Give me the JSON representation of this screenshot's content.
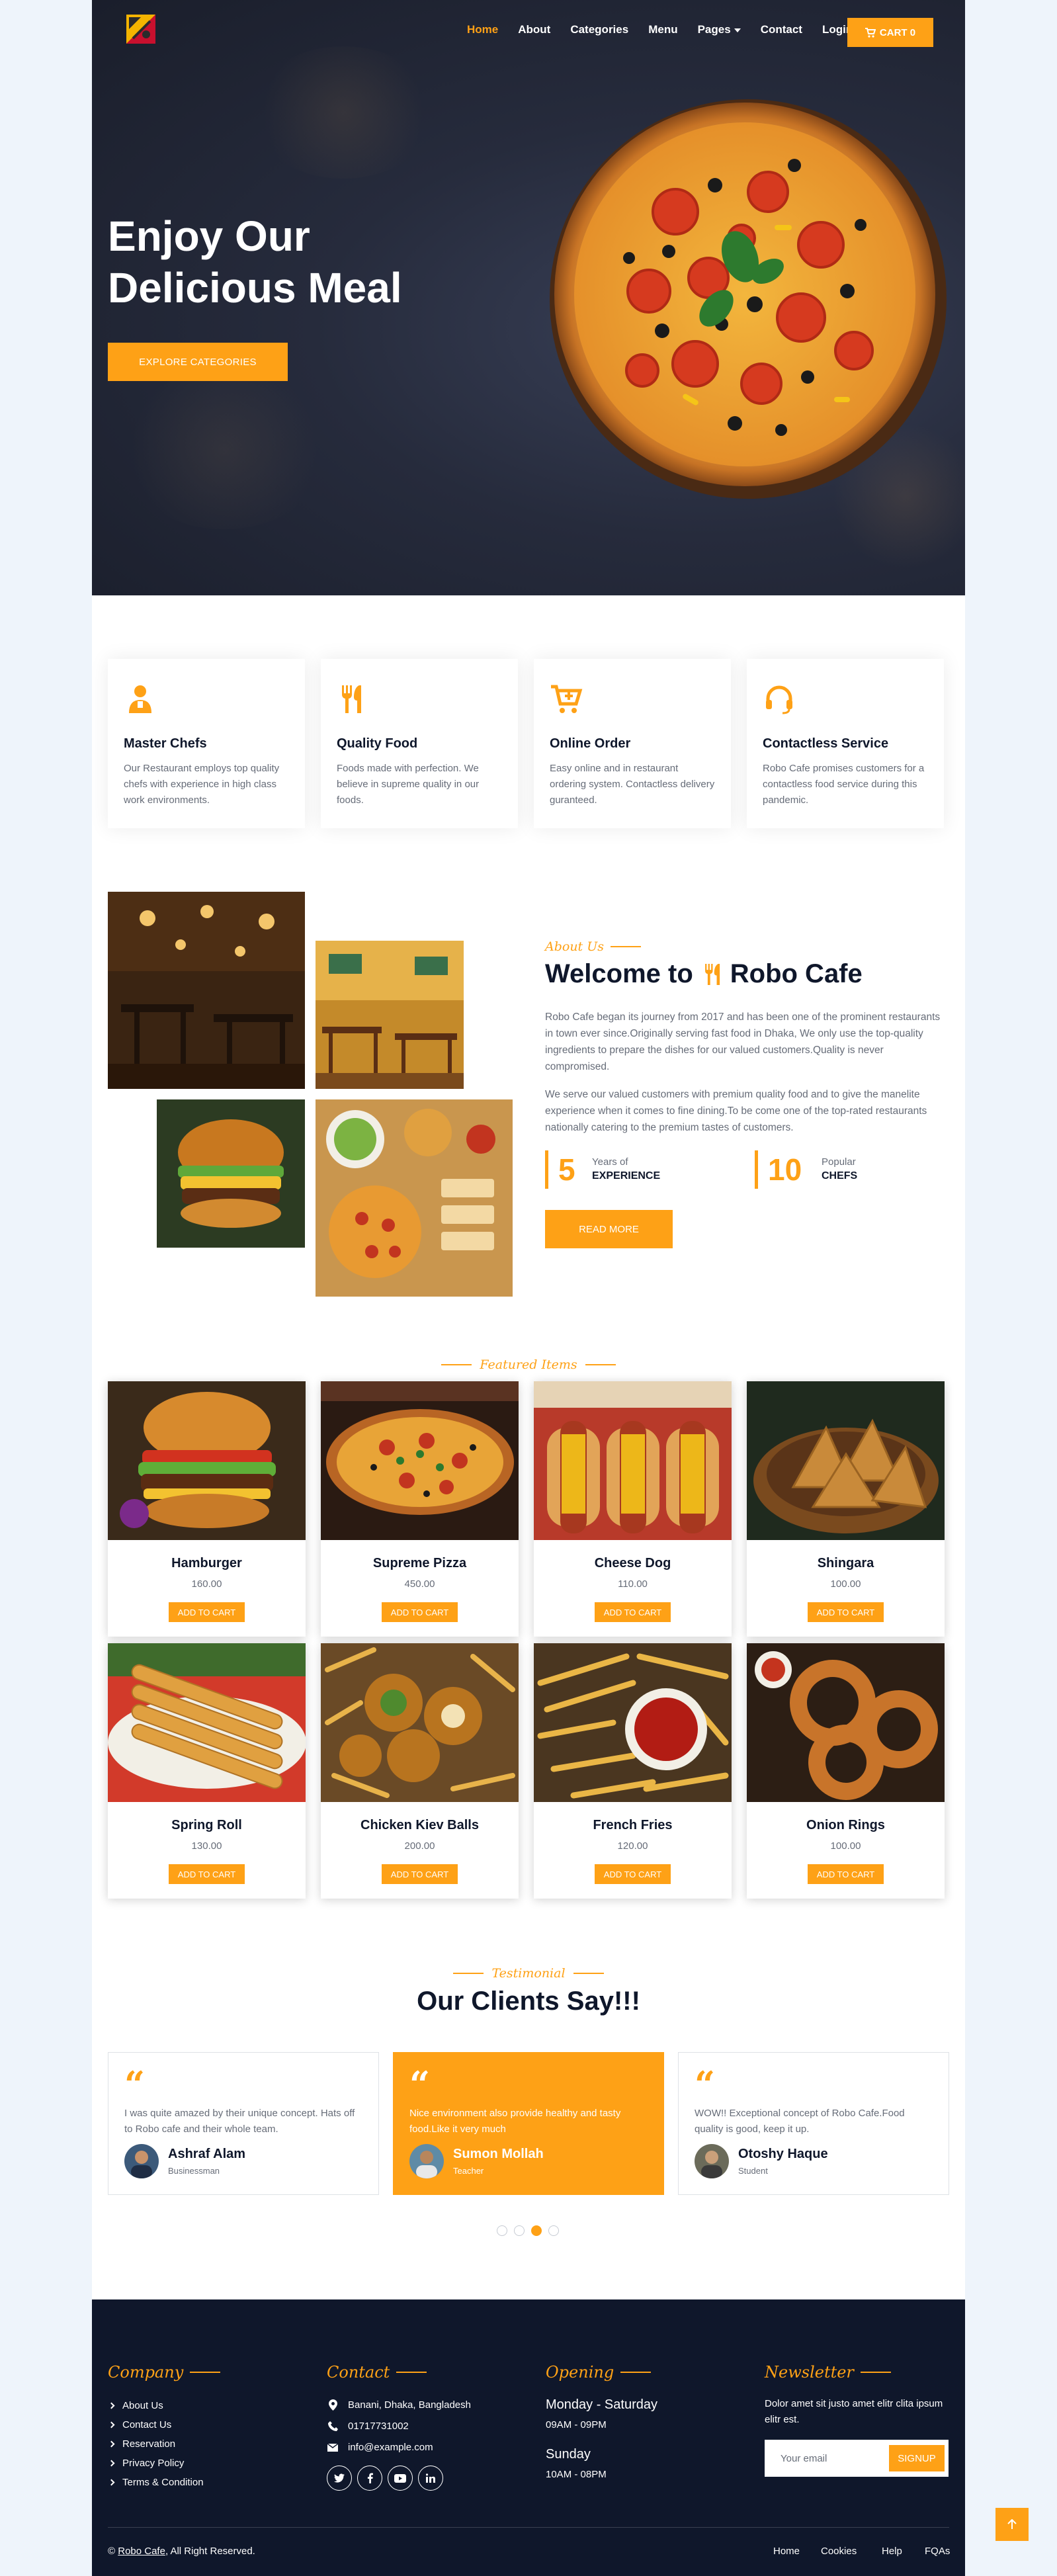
{
  "colors": {
    "accent": "#fea116",
    "dark": "#0f172b",
    "text": "#666c78"
  },
  "nav": {
    "items": [
      {
        "label": "Home",
        "active": true
      },
      {
        "label": "About"
      },
      {
        "label": "Categories"
      },
      {
        "label": "Menu"
      },
      {
        "label": "Pages",
        "dropdown": true
      },
      {
        "label": "Contact"
      },
      {
        "label": "Login"
      }
    ],
    "cart_label": "CART 0"
  },
  "hero": {
    "title_line1": "Enjoy Our",
    "title_line2": "Delicious Meal",
    "button": "EXPLORE CATEGORIES"
  },
  "services": [
    {
      "icon": "chef-icon",
      "title": "Master Chefs",
      "text": "Our Restaurant employs top quality chefs with experience in high class work environments."
    },
    {
      "icon": "utensils-icon",
      "title": "Quality Food",
      "text": "Foods made with perfection. We believe in supreme quality in our foods."
    },
    {
      "icon": "cart-plus-icon",
      "title": "Online Order",
      "text": "Easy online and in restaurant ordering system. Contactless delivery guranteed."
    },
    {
      "icon": "headset-icon",
      "title": "Contactless Service",
      "text": "Robo Cafe promises customers for a contactless food service during this pandemic."
    }
  ],
  "about": {
    "subtitle": "About Us",
    "title_prefix": "Welcome to",
    "title_brand": "Robo Cafe",
    "para1": "Robo Cafe began its journey from 2017 and has been one of the prominent restaurants in town ever since.Originally serving fast food in Dhaka, We only use the top-quality ingredients to prepare the dishes for our valued customers.Quality is never compromised.",
    "para2": "We serve our valued customers with premium quality food and to give the manelite experience when it comes to fine dining.To be come one of the top-rated restaurants nationally catering to the premium tastes of customers.",
    "stats": [
      {
        "number": "5",
        "small": "Years of",
        "big": "EXPERIENCE"
      },
      {
        "number": "10",
        "small": "Popular",
        "big": "CHEFS"
      }
    ],
    "button": "READ MORE"
  },
  "featured": {
    "label": "Featured Items",
    "button_label": "ADD TO CART",
    "items": [
      {
        "name": "Hamburger",
        "price": "160.00"
      },
      {
        "name": "Supreme Pizza",
        "price": "450.00"
      },
      {
        "name": "Cheese Dog",
        "price": "110.00"
      },
      {
        "name": "Shingara",
        "price": "100.00"
      },
      {
        "name": "Spring Roll",
        "price": "130.00"
      },
      {
        "name": "Chicken Kiev Balls",
        "price": "200.00"
      },
      {
        "name": "French Fries",
        "price": "120.00"
      },
      {
        "name": "Onion Rings",
        "price": "100.00"
      }
    ]
  },
  "testimonial": {
    "label": "Testimonial",
    "title": "Our Clients Say!!!",
    "items": [
      {
        "text": "I was quite amazed by their unique concept. Hats off to Robo cafe and their whole team.",
        "name": "Ashraf Alam",
        "role": "Businessman"
      },
      {
        "text": "Nice environment also provide healthy and tasty food.Like it very much",
        "name": "Sumon Mollah",
        "role": "Teacher",
        "active": true
      },
      {
        "text": "WOW!! Exceptional concept of Robo Cafe.Food quality is good, keep it up.",
        "name": "Otoshy Haque",
        "role": "Student"
      }
    ],
    "dots": 4,
    "active_dot": 3
  },
  "footer": {
    "company": {
      "heading": "Company",
      "links": [
        "About Us",
        "Contact Us",
        "Reservation",
        "Privacy Policy",
        "Terms & Condition"
      ]
    },
    "contact": {
      "heading": "Contact",
      "address": "Banani, Dhaka, Bangladesh",
      "phone": "01717731002",
      "email": "info@example.com",
      "socials": [
        "twitter-icon",
        "facebook-icon",
        "youtube-icon",
        "linkedin-icon"
      ]
    },
    "opening": {
      "heading": "Opening",
      "day1": "Monday - Saturday",
      "time1": "09AM - 09PM",
      "day2": "Sunday",
      "time2": "10AM - 08PM"
    },
    "newsletter": {
      "heading": "Newsletter",
      "text": "Dolor amet sit justo amet elitr clita ipsum elitr est.",
      "placeholder": "Your email",
      "button": "SIGNUP"
    },
    "copyright_brand": "Robo Cafe",
    "copyright_rest": ", All Right Reserved.",
    "copyright_symbol": "©",
    "menu": [
      "Home",
      "Cookies",
      "Help",
      "FQAs"
    ]
  }
}
